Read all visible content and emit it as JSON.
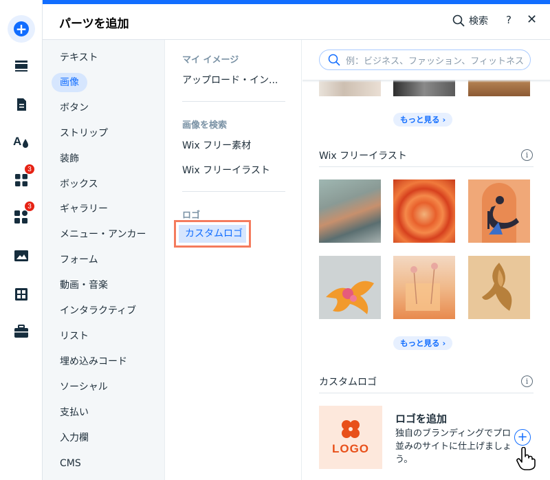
{
  "header": {
    "title": "パーツを追加",
    "search_label": "検索",
    "help_label": "?",
    "close_label": "✕"
  },
  "rail": {
    "items": [
      {
        "icon": "add-icon"
      },
      {
        "icon": "layout-icon"
      },
      {
        "icon": "pages-icon"
      },
      {
        "icon": "design-icon"
      },
      {
        "icon": "apps-icon",
        "badge": "3"
      },
      {
        "icon": "business-icon",
        "badge": "3"
      },
      {
        "icon": "media-icon"
      },
      {
        "icon": "table-icon"
      },
      {
        "icon": "portfolio-icon"
      }
    ]
  },
  "categories": {
    "items": [
      "テキスト",
      "画像",
      "ボタン",
      "ストリップ",
      "装飾",
      "ボックス",
      "ギャラリー",
      "メニュー・アンカー",
      "フォーム",
      "動画・音楽",
      "インタラクティブ",
      "リスト",
      "埋め込みコード",
      "ソーシャル",
      "支払い",
      "入力欄",
      "CMS"
    ],
    "selected": "画像"
  },
  "subcategories": {
    "my_images_heading": "マイ イメージ",
    "upload_label": "アップロード・イン...",
    "search_heading": "画像を検索",
    "free_media_label": "Wix フリー素材",
    "free_illustration_label": "Wix フリーイラスト",
    "logo_heading": "ロゴ",
    "custom_logo_label": "カスタムロゴ"
  },
  "panel": {
    "search_placeholder": "例：ビジネス、ファッション、フィットネス",
    "more_label_1": "もっと見る ›",
    "illustrations_title": "Wix フリーイラスト",
    "more_label_2": "もっと見る ›",
    "custom_logo_title": "カスタムロゴ",
    "info_label": "i",
    "logo_card": {
      "logo_text": "LOGO",
      "title": "ロゴを追加",
      "description": "独自のブランディングでプロ並みのサイトに仕上げましょう。",
      "add_label": "+"
    }
  },
  "colors": {
    "accent": "#116dff",
    "selected_bg": "#d6e6fe",
    "badge": "#e62214",
    "highlight_border": "#f47b5d",
    "logo_orange": "#e8501a"
  }
}
